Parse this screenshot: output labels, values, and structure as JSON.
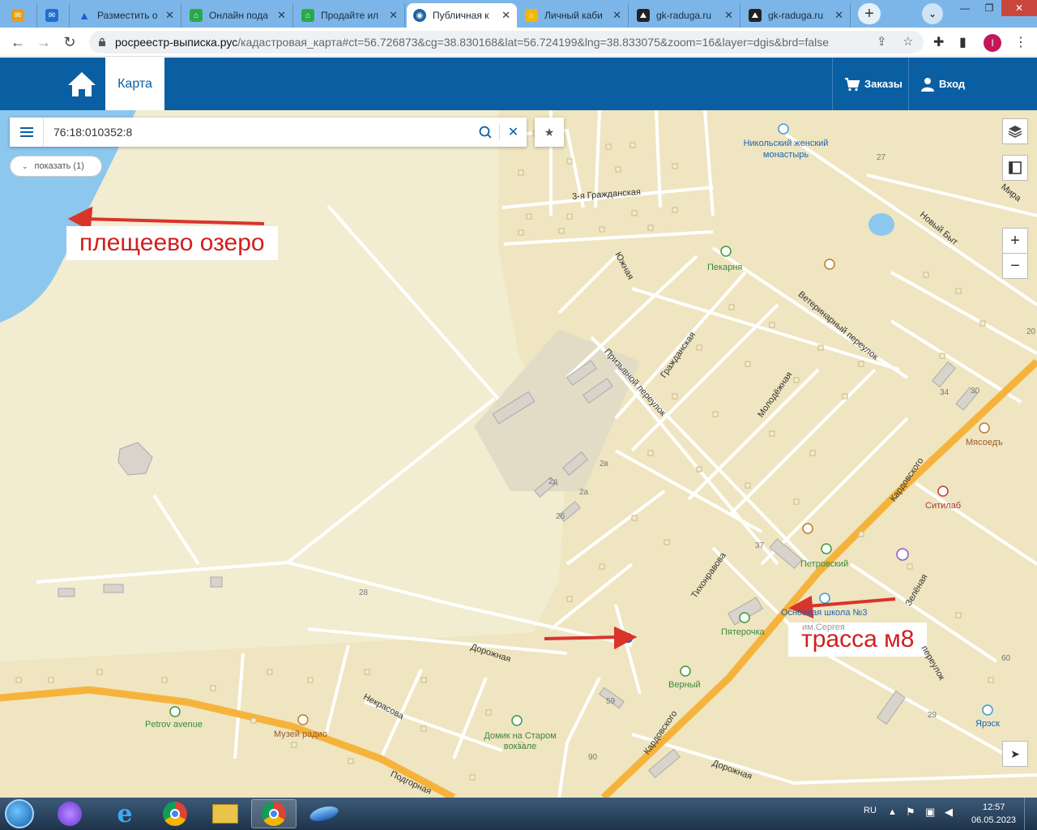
{
  "browser": {
    "tabs": [
      {
        "title": "",
        "icon": "mail-icon"
      },
      {
        "title": "",
        "icon": "outlook-mail-icon"
      },
      {
        "title": "Разместить о",
        "icon": "arrow-logo-icon"
      },
      {
        "title": "Онлайн пода",
        "icon": "house-logo-icon"
      },
      {
        "title": "Продайте ил",
        "icon": "house-logo-icon"
      },
      {
        "title": "Публичная к",
        "icon": "globe-icon"
      },
      {
        "title": "Личный каби",
        "icon": "house-yellow-icon"
      },
      {
        "title": "gk-raduga.ru",
        "icon": "mountain-logo-icon"
      },
      {
        "title": "gk-raduga.ru",
        "icon": "mountain-logo-icon"
      }
    ],
    "active_tab": 5,
    "url_host": "росреестр-выписка.рус",
    "url_path": "/кадастровая_карта#ct=56.726873&cg=38.830168&lat=56.724199&lng=38.833075&zoom=16&layer=dgis&brd=false",
    "profile_initial": "I"
  },
  "site": {
    "map_tab_label": "Карта",
    "orders_label": "Заказы",
    "login_label": "Вход"
  },
  "map": {
    "search_value": "76:18:010352:8",
    "show_button_label": "показать (1)",
    "zoom_in": "+",
    "zoom_out": "−",
    "annotations": {
      "lake": "плещеево озеро",
      "highway": "трасса м8"
    },
    "labels": {
      "monastery": "Никольский женский монастырь",
      "bakery": "Пекарня",
      "street_3grazhd": "3-я Гражданская",
      "street_yuzhnaya": "Южная",
      "street_vet": "Ветеринарный переулок",
      "street_grazhd": "Гражданская",
      "street_prizyv": "Призывной переулок",
      "street_molod": "Молодёжная",
      "street_mira": "Мира",
      "street_novbyt": "Новый Быт",
      "street_kard1": "Кардовского",
      "street_kard2": "Кардовского",
      "street_tikhon": "Тихонравова",
      "street_dorozh1": "Дорожная",
      "street_dorozh2": "Дорожная",
      "street_nekr": "Некрасова",
      "street_podgor": "Подгорная",
      "street_zelen": "Зелёная",
      "street_pereulok": "переулок",
      "myasoed": "Мясоедъ",
      "sitilab": "Ситилаб",
      "petrovsky": "Петровский",
      "school": "Основная школа №3",
      "school_sub": "им.Сергея",
      "pyaterochka": "Пятерочка",
      "verny": "Верный",
      "petrov_avenue": "Petrov avenue",
      "museum": "Музей радио",
      "domik": "Домик на Старом вокзале",
      "yaresk": "Ярэск",
      "n27": "27",
      "n34": "34",
      "n30": "30",
      "n2v": "2в",
      "n2d": "2д",
      "n2a": "2а",
      "n2b": "2б",
      "n28": "28",
      "n37": "37",
      "n59": "59",
      "n90": "90",
      "n60": "60",
      "n29": "29",
      "n20": "20"
    }
  },
  "taskbar": {
    "lang": "RU",
    "time": "12:57",
    "date": "06.05.2023"
  }
}
